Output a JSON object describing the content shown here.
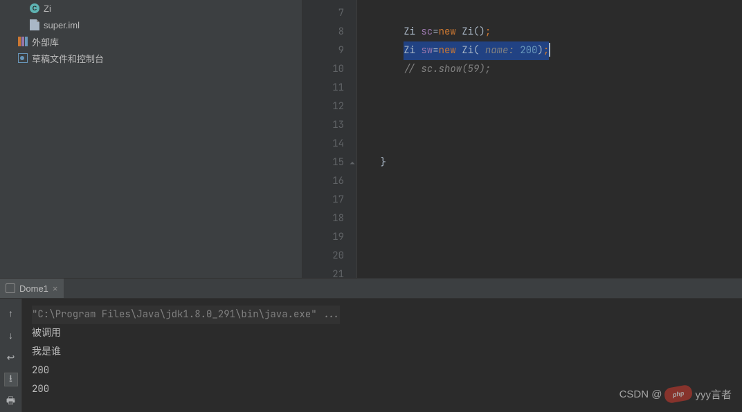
{
  "sidebar": {
    "items": [
      {
        "label": "Zi",
        "icon": "class"
      },
      {
        "label": "super.iml",
        "icon": "file"
      },
      {
        "label": "外部库",
        "icon": "library"
      },
      {
        "label": "草稿文件和控制台",
        "icon": "scratch"
      }
    ]
  },
  "editor": {
    "gutter_start": 7,
    "gutter_end": 21,
    "fold_line": 15,
    "code": {
      "line8_indent": "        ",
      "line8": {
        "cls1": "Zi ",
        "var": "sc",
        "eq": "=",
        "kw": "new",
        "cls2": " Zi",
        "paren": "()",
        "semi": ";"
      },
      "line9_indent": "        ",
      "line9": {
        "cls1": "Zi ",
        "var": "sw",
        "eq": "=",
        "kw": "new",
        "cls2": " Zi",
        "open": "( ",
        "param": "name: ",
        "num": "200",
        "close": ")",
        "semi": ";"
      },
      "line10_indent": "        ",
      "line10_comment": "// sc.show(59);",
      "line15_indent": "    ",
      "line15_brace": "}"
    }
  },
  "run": {
    "tab": "Dome1",
    "console": [
      "\"C:\\Program Files\\Java\\jdk1.8.0_291\\bin\\java.exe\" ...",
      "被调用",
      "我是谁",
      "200",
      "200"
    ]
  },
  "toolbar": {
    "icons": [
      "arrow-up",
      "arrow-down",
      "soft-wrap",
      "scroll-to-end",
      "print"
    ]
  },
  "watermark": {
    "left": "CSDN @",
    "logo": "php",
    "right": "yyy言者"
  }
}
